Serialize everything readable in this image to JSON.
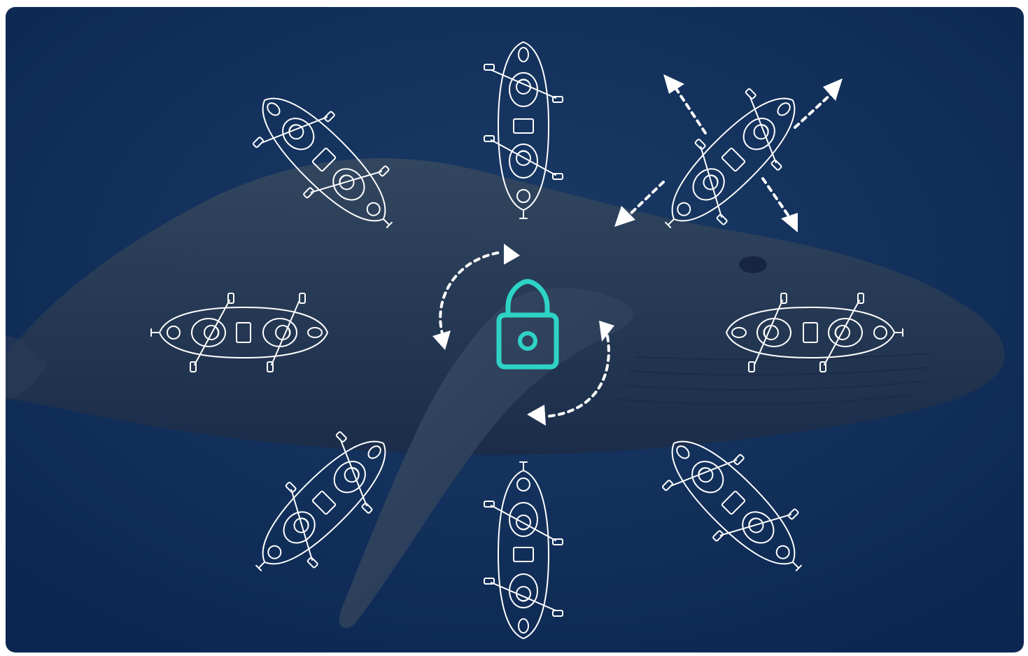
{
  "scene": {
    "background": "underwater-whale-photo",
    "colors": {
      "ocean_top": "#163560",
      "ocean_bottom": "#0c2a55",
      "whale_body": "#2a3e5e",
      "whale_shadow": "#1a2b47",
      "outline": "#ffffff",
      "lock_accent": "#2ed3c6"
    }
  },
  "center_icon": "lock-icon",
  "kayak_icon": "tandem-kayak-icon",
  "kayak_headings_deg": [
    0,
    45,
    90,
    135,
    180,
    225,
    270,
    315
  ],
  "rotation_arrows": {
    "count": 2,
    "direction": "clockwise"
  },
  "dispersal_arrows": {
    "count": 4,
    "style": "dashed"
  }
}
